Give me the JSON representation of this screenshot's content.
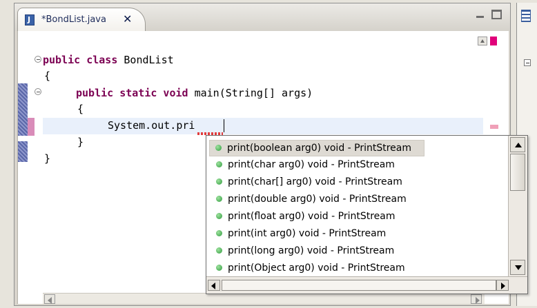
{
  "editor_tab": {
    "title": "*BondList.java",
    "close_glyph": "✕",
    "icon": "java-file-icon"
  },
  "window_buttons": {
    "minimize_icon": "minimize-icon",
    "maximize_icon": "maximize-icon"
  },
  "code_lines": {
    "line1_kw": "public class",
    "line1_rest": " BondList",
    "line2": "{",
    "line3_kw": "public static void",
    "line3_rest": " main(String[] args)",
    "line4": "{",
    "line5_typed": "System.out.pri",
    "line6": "}",
    "line7": "}"
  },
  "content_assist": {
    "proposals": [
      "print(boolean arg0)  void - PrintStream",
      "print(char arg0)  void - PrintStream",
      "print(char[] arg0)  void - PrintStream",
      "print(double arg0)  void - PrintStream",
      "print(float arg0)  void - PrintStream",
      "print(int arg0)  void - PrintStream",
      "print(long arg0)  void - PrintStream",
      "print(Object arg0)  void - PrintStream"
    ],
    "selected_index": 0,
    "proposal_icon": "public-method-icon",
    "proposal_icon_color": "#3aa648"
  },
  "colors": {
    "keyword": "#7b0052",
    "selection": "#dedad3",
    "current_line": "#e9f0fb",
    "error_marker": "#e0007a"
  }
}
